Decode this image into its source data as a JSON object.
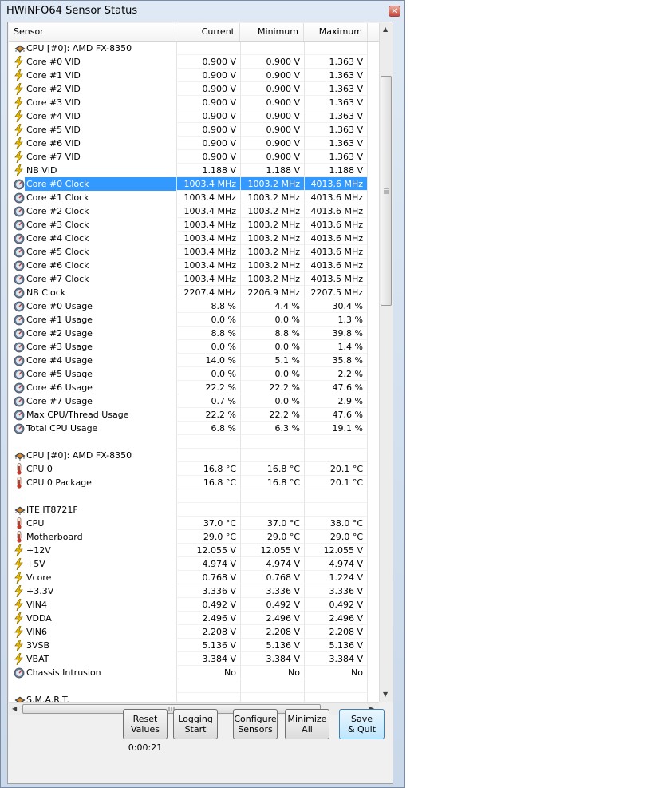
{
  "window": {
    "title": "HWiNFO64 Sensor Status",
    "close_label": "✕"
  },
  "columns": [
    "Sensor",
    "Current",
    "Minimum",
    "Maximum"
  ],
  "rows": [
    {
      "type": "group",
      "icon": "chip",
      "label": "CPU [#0]: AMD FX-8350",
      "cur": "",
      "min": "",
      "max": ""
    },
    {
      "type": "sensor",
      "icon": "voltage",
      "label": "Core #0 VID",
      "cur": "0.900 V",
      "min": "0.900 V",
      "max": "1.363 V"
    },
    {
      "type": "sensor",
      "icon": "voltage",
      "label": "Core #1 VID",
      "cur": "0.900 V",
      "min": "0.900 V",
      "max": "1.363 V"
    },
    {
      "type": "sensor",
      "icon": "voltage",
      "label": "Core #2 VID",
      "cur": "0.900 V",
      "min": "0.900 V",
      "max": "1.363 V"
    },
    {
      "type": "sensor",
      "icon": "voltage",
      "label": "Core #3 VID",
      "cur": "0.900 V",
      "min": "0.900 V",
      "max": "1.363 V"
    },
    {
      "type": "sensor",
      "icon": "voltage",
      "label": "Core #4 VID",
      "cur": "0.900 V",
      "min": "0.900 V",
      "max": "1.363 V"
    },
    {
      "type": "sensor",
      "icon": "voltage",
      "label": "Core #5 VID",
      "cur": "0.900 V",
      "min": "0.900 V",
      "max": "1.363 V"
    },
    {
      "type": "sensor",
      "icon": "voltage",
      "label": "Core #6 VID",
      "cur": "0.900 V",
      "min": "0.900 V",
      "max": "1.363 V"
    },
    {
      "type": "sensor",
      "icon": "voltage",
      "label": "Core #7 VID",
      "cur": "0.900 V",
      "min": "0.900 V",
      "max": "1.363 V"
    },
    {
      "type": "sensor",
      "icon": "voltage",
      "label": "NB VID",
      "cur": "1.188 V",
      "min": "1.188 V",
      "max": "1.188 V"
    },
    {
      "type": "sensor",
      "icon": "gauge",
      "label": "Core #0 Clock",
      "cur": "1003.4 MHz",
      "min": "1003.2 MHz",
      "max": "4013.6 MHz",
      "selected": true
    },
    {
      "type": "sensor",
      "icon": "gauge",
      "label": "Core #1 Clock",
      "cur": "1003.4 MHz",
      "min": "1003.2 MHz",
      "max": "4013.6 MHz"
    },
    {
      "type": "sensor",
      "icon": "gauge",
      "label": "Core #2 Clock",
      "cur": "1003.4 MHz",
      "min": "1003.2 MHz",
      "max": "4013.6 MHz"
    },
    {
      "type": "sensor",
      "icon": "gauge",
      "label": "Core #3 Clock",
      "cur": "1003.4 MHz",
      "min": "1003.2 MHz",
      "max": "4013.6 MHz"
    },
    {
      "type": "sensor",
      "icon": "gauge",
      "label": "Core #4 Clock",
      "cur": "1003.4 MHz",
      "min": "1003.2 MHz",
      "max": "4013.6 MHz"
    },
    {
      "type": "sensor",
      "icon": "gauge",
      "label": "Core #5 Clock",
      "cur": "1003.4 MHz",
      "min": "1003.2 MHz",
      "max": "4013.6 MHz"
    },
    {
      "type": "sensor",
      "icon": "gauge",
      "label": "Core #6 Clock",
      "cur": "1003.4 MHz",
      "min": "1003.2 MHz",
      "max": "4013.6 MHz"
    },
    {
      "type": "sensor",
      "icon": "gauge",
      "label": "Core #7 Clock",
      "cur": "1003.4 MHz",
      "min": "1003.2 MHz",
      "max": "4013.5 MHz"
    },
    {
      "type": "sensor",
      "icon": "gauge",
      "label": "NB Clock",
      "cur": "2207.4 MHz",
      "min": "2206.9 MHz",
      "max": "2207.5 MHz"
    },
    {
      "type": "sensor",
      "icon": "gauge",
      "label": "Core #0 Usage",
      "cur": "8.8 %",
      "min": "4.4 %",
      "max": "30.4 %"
    },
    {
      "type": "sensor",
      "icon": "gauge",
      "label": "Core #1 Usage",
      "cur": "0.0 %",
      "min": "0.0 %",
      "max": "1.3 %"
    },
    {
      "type": "sensor",
      "icon": "gauge",
      "label": "Core #2 Usage",
      "cur": "8.8 %",
      "min": "8.8 %",
      "max": "39.8 %"
    },
    {
      "type": "sensor",
      "icon": "gauge",
      "label": "Core #3 Usage",
      "cur": "0.0 %",
      "min": "0.0 %",
      "max": "1.4 %"
    },
    {
      "type": "sensor",
      "icon": "gauge",
      "label": "Core #4 Usage",
      "cur": "14.0 %",
      "min": "5.1 %",
      "max": "35.8 %"
    },
    {
      "type": "sensor",
      "icon": "gauge",
      "label": "Core #5 Usage",
      "cur": "0.0 %",
      "min": "0.0 %",
      "max": "2.2 %"
    },
    {
      "type": "sensor",
      "icon": "gauge",
      "label": "Core #6 Usage",
      "cur": "22.2 %",
      "min": "22.2 %",
      "max": "47.6 %"
    },
    {
      "type": "sensor",
      "icon": "gauge",
      "label": "Core #7 Usage",
      "cur": "0.7 %",
      "min": "0.0 %",
      "max": "2.9 %"
    },
    {
      "type": "sensor",
      "icon": "gauge",
      "label": "Max CPU/Thread Usage",
      "cur": "22.2 %",
      "min": "22.2 %",
      "max": "47.6 %"
    },
    {
      "type": "sensor",
      "icon": "gauge",
      "label": "Total CPU Usage",
      "cur": "6.8 %",
      "min": "6.3 %",
      "max": "19.1 %"
    },
    {
      "type": "blank",
      "icon": "",
      "label": "",
      "cur": "",
      "min": "",
      "max": ""
    },
    {
      "type": "group",
      "icon": "chip",
      "label": "CPU [#0]: AMD FX-8350",
      "cur": "",
      "min": "",
      "max": ""
    },
    {
      "type": "sensor",
      "icon": "thermometer",
      "label": "CPU 0",
      "cur": "16.8 °C",
      "min": "16.8 °C",
      "max": "20.1 °C"
    },
    {
      "type": "sensor",
      "icon": "thermometer",
      "label": "CPU 0 Package",
      "cur": "16.8 °C",
      "min": "16.8 °C",
      "max": "20.1 °C"
    },
    {
      "type": "blank",
      "icon": "",
      "label": "",
      "cur": "",
      "min": "",
      "max": ""
    },
    {
      "type": "group",
      "icon": "chip",
      "label": "ITE IT8721F",
      "cur": "",
      "min": "",
      "max": ""
    },
    {
      "type": "sensor",
      "icon": "thermometer",
      "label": "CPU",
      "cur": "37.0 °C",
      "min": "37.0 °C",
      "max": "38.0 °C"
    },
    {
      "type": "sensor",
      "icon": "thermometer",
      "label": "Motherboard",
      "cur": "29.0 °C",
      "min": "29.0 °C",
      "max": "29.0 °C"
    },
    {
      "type": "sensor",
      "icon": "voltage",
      "label": "+12V",
      "cur": "12.055 V",
      "min": "12.055 V",
      "max": "12.055 V"
    },
    {
      "type": "sensor",
      "icon": "voltage",
      "label": "+5V",
      "cur": "4.974 V",
      "min": "4.974 V",
      "max": "4.974 V"
    },
    {
      "type": "sensor",
      "icon": "voltage",
      "label": "Vcore",
      "cur": "0.768 V",
      "min": "0.768 V",
      "max": "1.224 V"
    },
    {
      "type": "sensor",
      "icon": "voltage",
      "label": "+3.3V",
      "cur": "3.336 V",
      "min": "3.336 V",
      "max": "3.336 V"
    },
    {
      "type": "sensor",
      "icon": "voltage",
      "label": "VIN4",
      "cur": "0.492 V",
      "min": "0.492 V",
      "max": "0.492 V"
    },
    {
      "type": "sensor",
      "icon": "voltage",
      "label": "VDDA",
      "cur": "2.496 V",
      "min": "2.496 V",
      "max": "2.496 V"
    },
    {
      "type": "sensor",
      "icon": "voltage",
      "label": "VIN6",
      "cur": "2.208 V",
      "min": "2.208 V",
      "max": "2.208 V"
    },
    {
      "type": "sensor",
      "icon": "voltage",
      "label": "3VSB",
      "cur": "5.136 V",
      "min": "5.136 V",
      "max": "5.136 V"
    },
    {
      "type": "sensor",
      "icon": "voltage",
      "label": "VBAT",
      "cur": "3.384 V",
      "min": "3.384 V",
      "max": "3.384 V"
    },
    {
      "type": "sensor",
      "icon": "gauge",
      "label": "Chassis Intrusion",
      "cur": "No",
      "min": "No",
      "max": "No"
    },
    {
      "type": "blank",
      "icon": "",
      "label": "",
      "cur": "",
      "min": "",
      "max": ""
    },
    {
      "type": "group",
      "icon": "chip",
      "label": "S.M.A.R.T.",
      "cur": "",
      "min": "",
      "max": ""
    }
  ],
  "buttons": [
    {
      "name": "reset-values-button",
      "line1": "Reset",
      "line2": "Values"
    },
    {
      "name": "logging-start-button",
      "line1": "Logging",
      "line2": "Start"
    },
    {
      "name": "configure-sensors-button",
      "line1": "Configure",
      "line2": "Sensors"
    },
    {
      "name": "minimize-all-button",
      "line1": "Minimize",
      "line2": "All"
    },
    {
      "name": "save-quit-button",
      "line1": "Save",
      "line2": "& Quit"
    }
  ],
  "timer": "0:00:21",
  "colors": {
    "selection": "#3399ff",
    "voltage_icon": "#f2c200",
    "gauge_icon": "#5a6b80",
    "thermometer_icon": "#c0392b"
  }
}
